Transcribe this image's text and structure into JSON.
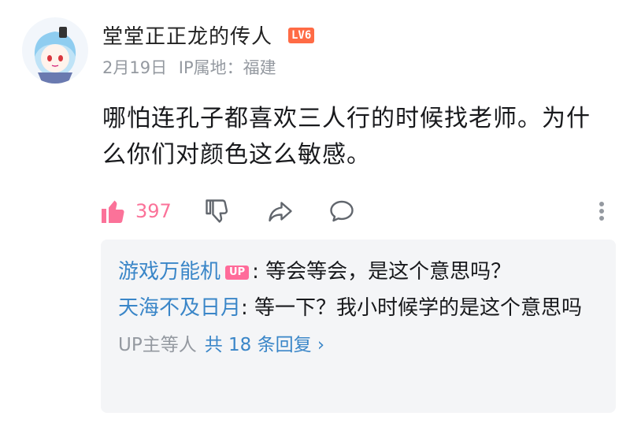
{
  "post": {
    "username": "堂堂正正龙的传人",
    "level": "LV6",
    "date": "2月19日",
    "ip_location": "IP属地：福建",
    "content": "哪怕连孔子都喜欢三人行的时候找老师。为什么你们对颜色这么敏感。",
    "like_count": "397"
  },
  "replies": {
    "items": [
      {
        "name": "游戏万能机",
        "badge": "UP",
        "separator": ": ",
        "text": "等会等会，是这个意思吗？"
      },
      {
        "name": "天海不及日月",
        "separator": ": ",
        "text": "等一下？我小时候学的是这个意思吗"
      }
    ],
    "footer_prefix": "UP主等人",
    "footer_count": "共 18 条回复",
    "footer_arrow": "›"
  },
  "icons": {
    "like": "thumbs-up-icon",
    "dislike": "thumbs-down-icon",
    "share": "share-icon",
    "reply": "comment-icon",
    "more": "more-vertical-icon"
  },
  "colors": {
    "like_accent": "#fb7299",
    "username_link": "#3a86c8",
    "level_badge": "#ff6b45",
    "up_badge": "#ff6b9a",
    "muted": "#9499a0"
  }
}
